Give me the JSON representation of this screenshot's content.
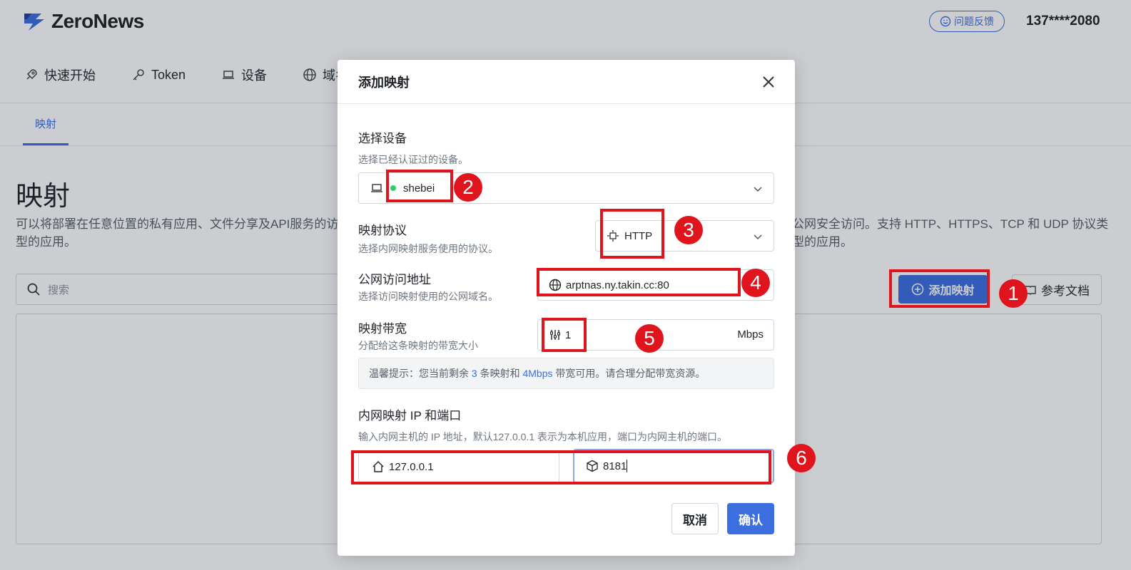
{
  "header": {
    "logo_text": "ZeroNews",
    "feedback_label": "问题反馈",
    "user_phone": "137****2080"
  },
  "topnav": {
    "items": [
      {
        "label": "快速开始",
        "icon": "rocket-icon"
      },
      {
        "label": "Token",
        "icon": "key-icon"
      },
      {
        "label": "设备",
        "icon": "laptop-icon"
      },
      {
        "label": "域名",
        "icon": "globe-icon"
      }
    ]
  },
  "subnav": {
    "active_tab": "映射"
  },
  "page": {
    "title": "映射",
    "desc_left": "可以将部署在任意位置的私有应用、文件分享及API服务的访",
    "desc_right": "公网安全访问。支持 HTTP、HTTPS、TCP 和 UDP 协议类型的应用。",
    "desc_line2": "型的应用。",
    "search_placeholder": "搜索",
    "add_button": "添加映射",
    "ref_doc_button": "参考文档"
  },
  "modal": {
    "title": "添加映射",
    "device": {
      "label": "选择设备",
      "hint": "选择已经认证过的设备。",
      "value": "shebei",
      "status_color": "#2ecc71"
    },
    "protocol": {
      "label": "映射协议",
      "hint": "选择内网映射服务使用的协议。",
      "value": "HTTP"
    },
    "public_address": {
      "label": "公网访问地址",
      "hint": "选择访问映射使用的公网域名。",
      "value": "arptnas.ny.takin.cc:80"
    },
    "bandwidth": {
      "label": "映射带宽",
      "hint": "分配给这条映射的带宽大小",
      "value": "1",
      "unit": "Mbps"
    },
    "tip": {
      "prefix": "温馨提示：您当前剩余 ",
      "remaining_maps": "3",
      "middle": " 条映射和 ",
      "remaining_bandwidth": "4Mbps",
      "suffix": " 带宽可用。请合理分配带宽资源。"
    },
    "internal": {
      "label": "内网映射 IP 和端口",
      "hint": "输入内网主机的 IP 地址，默认127.0.0.1 表示为本机应用，端口为内网主机的端口。",
      "ip": "127.0.0.1",
      "port": "8181"
    },
    "cancel_label": "取消",
    "confirm_label": "确认"
  },
  "annotations": [
    "1",
    "2",
    "3",
    "4",
    "5",
    "6"
  ],
  "colors": {
    "accent": "#3b6fe0",
    "annotation": "#e0141c"
  }
}
